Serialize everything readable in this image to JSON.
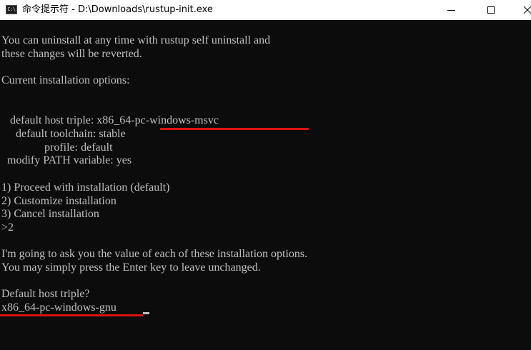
{
  "window": {
    "icon_label": "C:\\",
    "title": "命令提示符 - D:\\Downloads\\rustup-init.exe"
  },
  "controls": {
    "minimize": "—",
    "maximize": "☐",
    "close": "✕"
  },
  "console": {
    "lines": [
      "You can uninstall at any time with rustup self uninstall and",
      "these changes will be reverted.",
      "",
      "Current installation options:",
      "",
      "",
      "   default host triple: x86_64-pc-windows-msvc",
      "     default toolchain: stable",
      "               profile: default",
      "  modify PATH variable: yes",
      "",
      "1) Proceed with installation (default)",
      "2) Customize installation",
      "3) Cancel installation",
      ">2",
      "",
      "I'm going to ask you the value of each of these installation options.",
      "You may simply press the Enter key to leave unchanged.",
      "",
      "Default host triple?",
      "x86_64-pc-windows-gnu"
    ]
  },
  "colors": {
    "console_bg": "#0c0c0c",
    "console_text": "#c0c0c0",
    "annotation_underline": "#e01010"
  }
}
